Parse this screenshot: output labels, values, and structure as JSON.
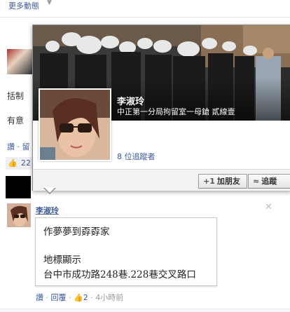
{
  "feed": {
    "more_label": "更多動態",
    "snippet_1": "括制",
    "snippet_2": "有意",
    "actions": "讚 · 留",
    "like_count": "22"
  },
  "hovercard": {
    "name": "李淑玲",
    "subtitle": "中正第一分局拘留室一母鎗 貳線壹",
    "followers": "8 位追蹤者",
    "add_friend_label": "加朋友",
    "follow_label": "追蹤"
  },
  "comment": {
    "author": "李淑玲",
    "line1": "作夢夢到孬孬家",
    "line2": "地標顯示",
    "line3": "台中市成功路248巷.228巷交叉路口",
    "like_label": "讚",
    "reply_label": "回覆",
    "likes": "2",
    "time": "4小時前"
  },
  "colors": {
    "link": "#3b5998",
    "border": "#8c8c8c"
  }
}
